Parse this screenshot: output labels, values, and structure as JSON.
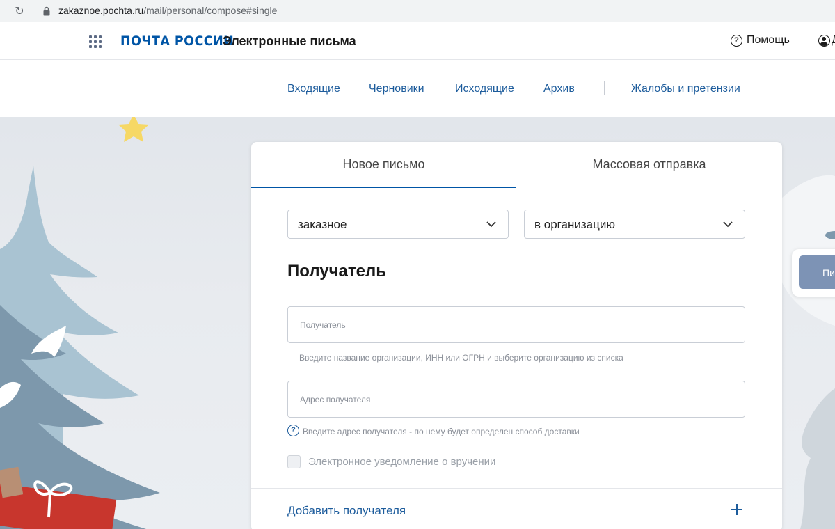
{
  "browser": {
    "url_host": "zakaznoe.pochta.ru",
    "url_path": "/mail/personal/compose#single"
  },
  "header": {
    "logo_text": "ПОЧТА РОССИИ",
    "service_title": "Электронные письма",
    "help_label": "Помощь",
    "user_label": "Д"
  },
  "subnav": {
    "items": [
      "Входящие",
      "Черновики",
      "Исходящие",
      "Архив",
      "Жалобы и претензии"
    ]
  },
  "card": {
    "tabs": [
      "Новое письмо",
      "Массовая отправка"
    ],
    "active_tab": 0,
    "letter_type": "заказное",
    "recipient_type": "в организацию",
    "section_title": "Получатель",
    "recipient_placeholder": "Получатель",
    "recipient_hint": "Введите название организации, ИНН или ОГРН и выберите организацию из списка",
    "address_placeholder": "Адрес получателя",
    "address_hint": "Введите адрес получателя - по нему будет определен способ доставки",
    "notification_label": "Электронное уведомление о вручении",
    "notification_checked": false,
    "add_recipient_label": "Добавить получателя"
  },
  "side_card": {
    "button_label": "Пи"
  },
  "colors": {
    "brand_blue": "#0055a6",
    "link_blue": "#1d5c9c",
    "hint_gray": "#8a8f98"
  }
}
